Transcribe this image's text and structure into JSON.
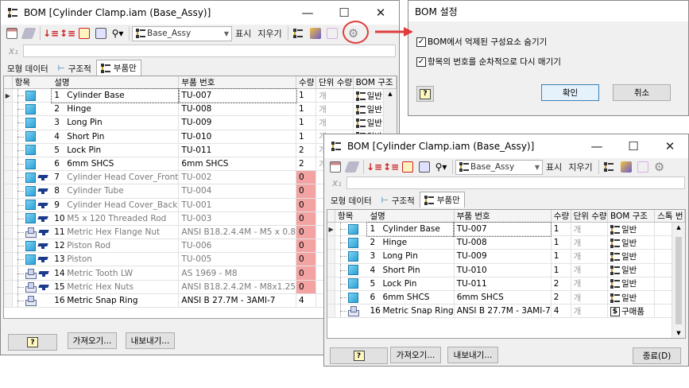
{
  "window1": {
    "title": "BOM [Cylinder Clamp.iam (Base_Assy)]",
    "view_combo": "Base_Assy",
    "toolbar_show": "표시",
    "toolbar_clear": "지우기",
    "tabs": [
      "모형 데이터",
      "구조적",
      "부품만"
    ],
    "columns": [
      "항목",
      "설명",
      "부품 번호",
      "수량",
      "단위 수량",
      "BOM 구조"
    ],
    "rows": [
      {
        "no": "1",
        "desc": "Cylinder Base",
        "pn": "TU-007",
        "qty": "1",
        "unit": "개",
        "bom": "일반",
        "icon": "part-icon",
        "extra": ""
      },
      {
        "no": "2",
        "desc": "Hinge",
        "pn": "TU-008",
        "qty": "1",
        "unit": "개",
        "bom": "일반",
        "icon": "part-icon",
        "extra": ""
      },
      {
        "no": "3",
        "desc": "Long Pin",
        "pn": "TU-009",
        "qty": "1",
        "unit": "개",
        "bom": "일반",
        "icon": "part-icon",
        "extra": ""
      },
      {
        "no": "4",
        "desc": "Short Pin",
        "pn": "TU-010",
        "qty": "1",
        "unit": "개",
        "bom": "일반",
        "icon": "part-icon",
        "extra": ""
      },
      {
        "no": "5",
        "desc": "Lock Pin",
        "pn": "TU-011",
        "qty": "2",
        "unit": "개",
        "bom": "일반",
        "icon": "part-icon",
        "extra": ""
      },
      {
        "no": "6",
        "desc": "6mm SHCS",
        "pn": "6mm SHCS",
        "qty": "2",
        "unit": "개",
        "bom": "일반",
        "icon": "part-icon",
        "extra": ""
      },
      {
        "no": "7",
        "desc": "Cylinder Head Cover_Front",
        "pn": "TU-002",
        "qty": "0",
        "unit": "",
        "bom": "",
        "icon": "part-icon",
        "extra": "hat"
      },
      {
        "no": "8",
        "desc": "Cylinder Tube",
        "pn": "TU-004",
        "qty": "0",
        "unit": "",
        "bom": "",
        "icon": "part-icon",
        "extra": "hat"
      },
      {
        "no": "9",
        "desc": "Cylinder Head Cover_Back",
        "pn": "TU-001",
        "qty": "0",
        "unit": "",
        "bom": "",
        "icon": "part-icon",
        "extra": "hat"
      },
      {
        "no": "10",
        "desc": "M5 x 120 Threaded Rod",
        "pn": "TU-003",
        "qty": "0",
        "unit": "",
        "bom": "",
        "icon": "part-icon",
        "extra": "hat"
      },
      {
        "no": "11",
        "desc": "Metric Hex Flange Nut",
        "pn": "ANSI B18.2.4.4M - M5 x 0.8",
        "qty": "0",
        "unit": "",
        "bom": "",
        "icon": "assembly-icon",
        "extra": "hat"
      },
      {
        "no": "12",
        "desc": "Piston Rod",
        "pn": "TU-006",
        "qty": "0",
        "unit": "",
        "bom": "",
        "icon": "part-icon",
        "extra": "hat"
      },
      {
        "no": "13",
        "desc": "Piston",
        "pn": "TU-005",
        "qty": "0",
        "unit": "",
        "bom": "",
        "icon": "part-icon",
        "extra": "hat"
      },
      {
        "no": "14",
        "desc": "Metric Tooth LW",
        "pn": "AS 1969 - M8",
        "qty": "0",
        "unit": "",
        "bom": "",
        "icon": "assembly-icon",
        "extra": "hat"
      },
      {
        "no": "15",
        "desc": "Metric Hex Nuts",
        "pn": "ANSI B18.2.4.2M - M8x1.25",
        "qty": "0",
        "unit": "",
        "bom": "",
        "icon": "assembly-icon",
        "extra": "hat"
      },
      {
        "no": "16",
        "desc": "Metric Snap Ring",
        "pn": "ANSI B 27.7M - 3AMI-7",
        "qty": "4",
        "unit": "",
        "bom": "",
        "icon": "assembly-icon",
        "extra": ""
      }
    ],
    "import_btn": "가져오기...",
    "export_btn": "내보내기...",
    "help_glyph": "?"
  },
  "dialog": {
    "title": "BOM 설정",
    "opt1": "BOM에서 억제된 구성요소 숨기기",
    "opt2": "항목의 번호를 순차적으로 다시 매기기",
    "ok": "확인",
    "cancel": "취소",
    "help_glyph": "?"
  },
  "window2": {
    "title": "BOM [Cylinder Clamp.iam (Base_Assy)]",
    "view_combo": "Base_Assy",
    "toolbar_show": "표시",
    "toolbar_clear": "지우기",
    "tabs": [
      "모형 데이터",
      "구조적",
      "부품만"
    ],
    "columns": [
      "항목",
      "설명",
      "부품 번호",
      "수량",
      "단위 수량",
      "BOM 구조",
      "스톡 번"
    ],
    "rows": [
      {
        "no": "1",
        "desc": "Cylinder Base",
        "pn": "TU-007",
        "qty": "1",
        "unit": "개",
        "bom": "일반",
        "icon": "part-icon"
      },
      {
        "no": "2",
        "desc": "Hinge",
        "pn": "TU-008",
        "qty": "1",
        "unit": "개",
        "bom": "일반",
        "icon": "part-icon"
      },
      {
        "no": "3",
        "desc": "Long Pin",
        "pn": "TU-009",
        "qty": "1",
        "unit": "개",
        "bom": "일반",
        "icon": "part-icon"
      },
      {
        "no": "4",
        "desc": "Short Pin",
        "pn": "TU-010",
        "qty": "1",
        "unit": "개",
        "bom": "일반",
        "icon": "part-icon"
      },
      {
        "no": "5",
        "desc": "Lock Pin",
        "pn": "TU-011",
        "qty": "2",
        "unit": "개",
        "bom": "일반",
        "icon": "part-icon"
      },
      {
        "no": "6",
        "desc": "6mm SHCS",
        "pn": "6mm SHCS",
        "qty": "2",
        "unit": "개",
        "bom": "일반",
        "icon": "part-icon"
      },
      {
        "no": "16",
        "desc": "Metric Snap Ring",
        "pn": "ANSI B 27.7M - 3AMI-7",
        "qty": "4",
        "unit": "개",
        "bom": "구매품",
        "icon": "assembly-icon"
      }
    ],
    "import_btn": "가져오기...",
    "export_btn": "내보내기...",
    "close_btn": "종료(D)",
    "help_glyph": "?"
  },
  "colors": {
    "accent_red": "#e03c3c",
    "suppressed_qty": "#f4a3a3",
    "part_blue": "#2a9fd4"
  }
}
